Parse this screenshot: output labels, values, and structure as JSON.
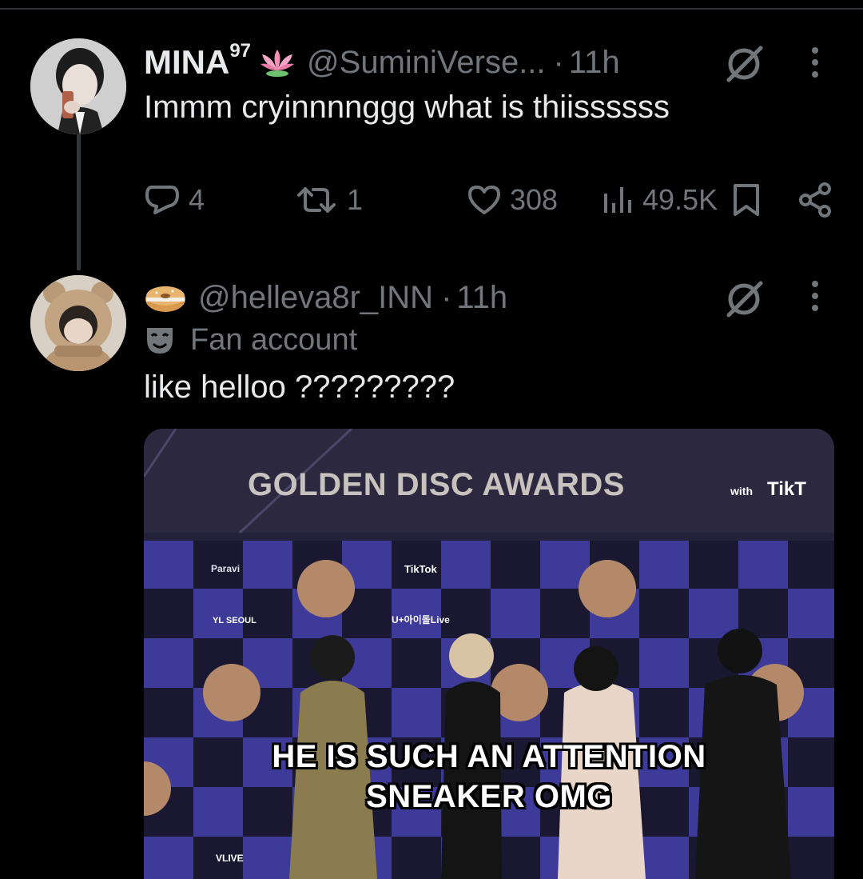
{
  "tweet1": {
    "display_name": "MINA",
    "name_superscript": "97",
    "name_emoji": "lotus-icon",
    "handle": "@SuminiVerse...",
    "separator": "·",
    "time": "11h",
    "text": "Immm cryinnnnggg what is thiissssss",
    "stats": {
      "replies": "4",
      "retweets": "1",
      "likes": "308",
      "views": "49.5K"
    }
  },
  "tweet2": {
    "name_emoji": "bagel-icon",
    "handle": "@helleva8r_INN",
    "separator": "·",
    "time": "11h",
    "badge_icon": "masks-icon",
    "badge_label": "Fan account",
    "text": "like helloo ?????????",
    "media": {
      "banner": "GOLDEN DISC AWARDS",
      "banner_suffix_small": "with",
      "banner_suffix": "TikT",
      "sponsor_labels": [
        "Paravi",
        "TikTok",
        "U+아이돌Live",
        "VLIVE",
        "YL SEOUL"
      ],
      "subtitle_line1": "HE IS SUCH AN ATTENTION",
      "subtitle_line2": "SNEAKER OMG"
    }
  },
  "colors": {
    "background": "#000000",
    "text_primary": "#e7e9ea",
    "text_secondary": "#71767b",
    "divider": "#2f3336",
    "backdrop_purple": "#3d3a9a",
    "backdrop_dark": "#1a1830"
  }
}
